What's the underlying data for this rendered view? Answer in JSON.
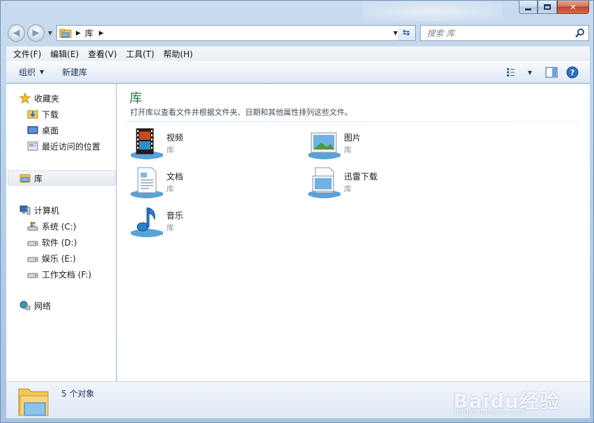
{
  "window": {
    "caption": {
      "minimize": "",
      "maximize": "",
      "close": "✕"
    }
  },
  "address": {
    "crumb": "库",
    "search_placeholder": "搜索 库"
  },
  "menubar": {
    "items": [
      "文件(F)",
      "编辑(E)",
      "查看(V)",
      "工具(T)",
      "帮助(H)"
    ]
  },
  "commandbar": {
    "organize": "组织",
    "new_library": "新建库"
  },
  "navpane": {
    "favorites": {
      "label": "收藏夹",
      "items": [
        "下载",
        "桌面",
        "最近访问的位置"
      ]
    },
    "libraries": {
      "label": "库"
    },
    "computer": {
      "label": "计算机",
      "drives": [
        "系统 (C:)",
        "软件 (D:)",
        "娱乐 (E:)",
        "工作文档 (F:)"
      ]
    },
    "network": {
      "label": "网络"
    }
  },
  "content": {
    "title": "库",
    "description": "打开库以查看文件并根据文件夹、日期和其他属性排列这些文件。",
    "libraries": [
      {
        "name": "视频",
        "type": "库",
        "icon": "video-library-icon"
      },
      {
        "name": "图片",
        "type": "库",
        "icon": "pictures-library-icon"
      },
      {
        "name": "文档",
        "type": "库",
        "icon": "documents-library-icon"
      },
      {
        "name": "迅雷下载",
        "type": "库",
        "icon": "download-library-icon"
      },
      {
        "name": "音乐",
        "type": "库",
        "icon": "music-library-icon"
      }
    ]
  },
  "details": {
    "count_text": "5 个对象"
  },
  "watermark": {
    "brand": "Baidu经验",
    "url": "jingyan.baidu.com"
  },
  "colors": {
    "title_green": "#1f7a4a",
    "frame_blue": "#b9d1ea"
  }
}
